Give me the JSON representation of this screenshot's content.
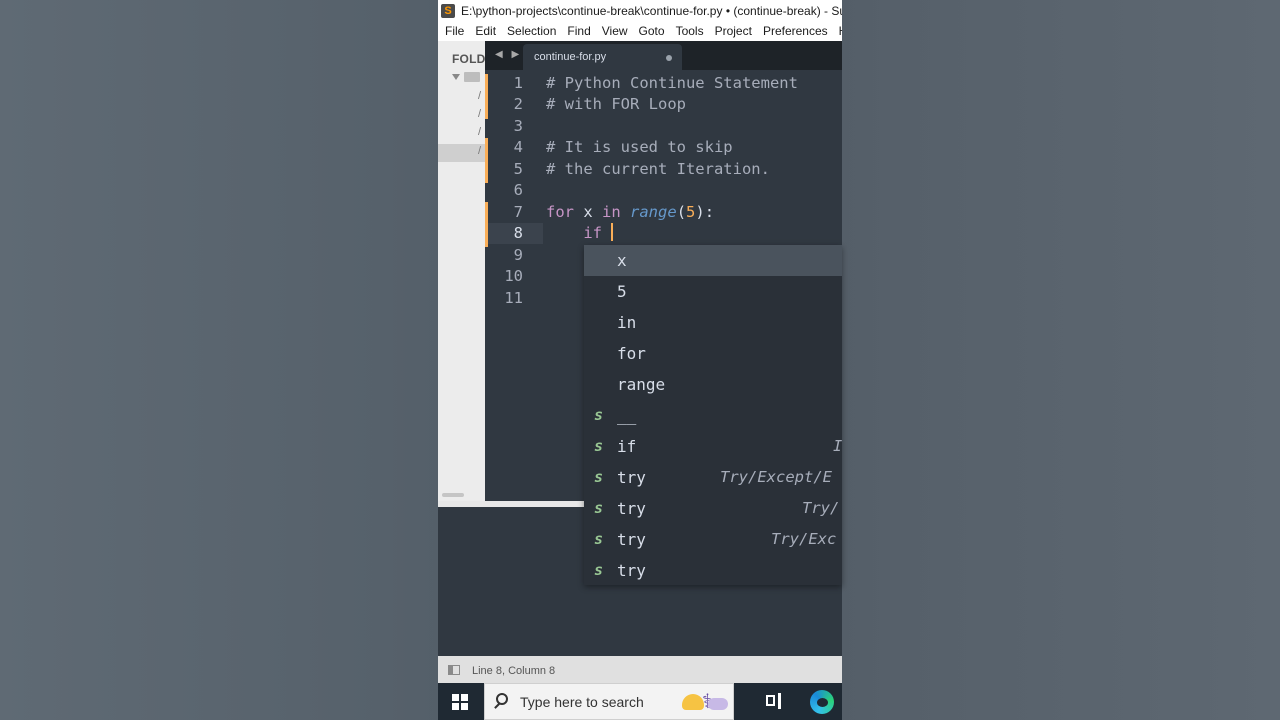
{
  "window": {
    "title": "E:\\python-projects\\continue-break\\continue-for.py • (continue-break) - Subli"
  },
  "menu": [
    "File",
    "Edit",
    "Selection",
    "Find",
    "View",
    "Goto",
    "Tools",
    "Project",
    "Preferences",
    "He"
  ],
  "sidebar": {
    "header": "FOLD",
    "items": [
      "/",
      "/",
      "/",
      "/"
    ]
  },
  "tab": {
    "name": "continue-for.py",
    "nav_arrows": "◀ ▶"
  },
  "editor": {
    "line_numbers": [
      "1",
      "2",
      "3",
      "4",
      "5",
      "6",
      "7",
      "8",
      "9",
      "10",
      "11"
    ],
    "active_line": "8",
    "lines": {
      "l1": "# Python Continue Statement",
      "l2": "# with FOR Loop",
      "l4": "# It is used to skip",
      "l5": "# the current Iteration.",
      "l7_kw1": "for",
      "l7_var": " x ",
      "l7_kw2": "in",
      "l7_fn": "range",
      "l7_open": "(",
      "l7_num": "5",
      "l7_close": "):",
      "l8_indent": "    ",
      "l8_kw": "if",
      "l8_space": " "
    }
  },
  "autocomplete": {
    "items": [
      {
        "kind": "",
        "trigger": "x",
        "annotation": ""
      },
      {
        "kind": "",
        "trigger": "5",
        "annotation": ""
      },
      {
        "kind": "",
        "trigger": "in",
        "annotation": ""
      },
      {
        "kind": "",
        "trigger": "for",
        "annotation": ""
      },
      {
        "kind": "",
        "trigger": "range",
        "annotation": ""
      },
      {
        "kind": "s",
        "trigger": "__",
        "annotation": ""
      },
      {
        "kind": "s",
        "trigger": "if",
        "annotation": "I"
      },
      {
        "kind": "s",
        "trigger": "try",
        "annotation": "Try/Except/E"
      },
      {
        "kind": "s",
        "trigger": "try",
        "annotation": "Try/"
      },
      {
        "kind": "s",
        "trigger": "try",
        "annotation": "Try/Exc"
      },
      {
        "kind": "s",
        "trigger": "try",
        "annotation": ""
      }
    ]
  },
  "statusbar": {
    "position": "Line 8, Column 8"
  },
  "taskbar": {
    "search_placeholder": "Type here to search"
  },
  "colors": {
    "editor_bg": "#303841",
    "comment": "#a7adba",
    "keyword": "#c695c6",
    "function": "#6699cc",
    "number": "#f9ae58",
    "snippet_kind": "#99c794"
  }
}
